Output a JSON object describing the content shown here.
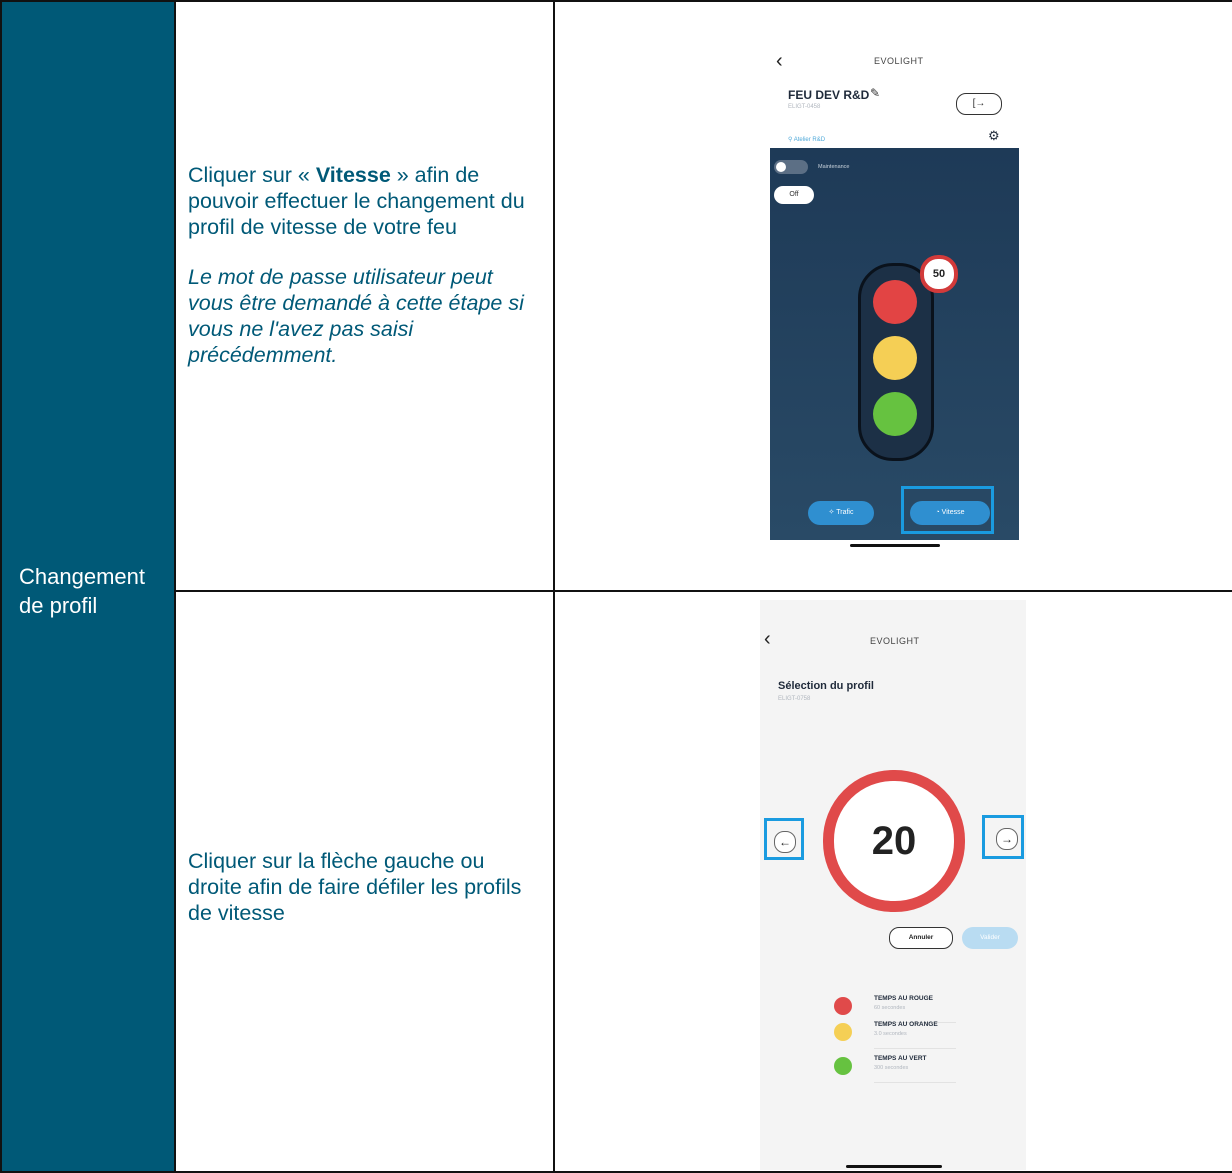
{
  "left_label": "Changement de profil",
  "row1": {
    "instruction": {
      "before": "Cliquer sur « ",
      "bold": "Vitesse",
      "after": " » afin de pouvoir effectuer le changement du profil de vitesse de votre feu"
    },
    "note": "Le mot de passe utilisateur peut vous être demandé à cette étape si vous ne l'avez pas saisi précédemment.",
    "screen": {
      "back_icon": "chevron-left-icon",
      "app_title": "EVOLIGHT",
      "device_name": "FEU DEV R&D",
      "device_id": "ELIGT-0458",
      "location": "Atelier R&D",
      "logout_icon": "logout-icon",
      "maintenance_label": "Maintenance",
      "off_label": "Off",
      "speed_sign": "50",
      "trafic_label": "Trafic",
      "vitesse_label": "Vitesse",
      "colors": {
        "red": "#e24444",
        "yellow": "#f5cf55",
        "green": "#66c240",
        "highlight": "#1a9be0"
      }
    }
  },
  "row2": {
    "instruction": "Cliquer sur la flèche gauche ou droite afin de faire défiler les profils de vitesse",
    "screen": {
      "back_icon": "chevron-left-icon",
      "app_title": "EVOLIGHT",
      "title": "Sélection du profil",
      "device_id": "ELIGT-0758",
      "speed_value": "20",
      "left_arrow": "←",
      "right_arrow": "→",
      "legend": [
        {
          "name": "TEMPS AU ROUGE",
          "value": "60 secondes",
          "color": "#e04a4a"
        },
        {
          "name": "TEMPS AU ORANGE",
          "value": "3.0 secondes",
          "color": "#f5cf55"
        },
        {
          "name": "TEMPS AU VERT",
          "value": "300 secondes",
          "color": "#66c240"
        }
      ],
      "cancel_label": "Annuler",
      "validate_label": "Valider"
    }
  }
}
